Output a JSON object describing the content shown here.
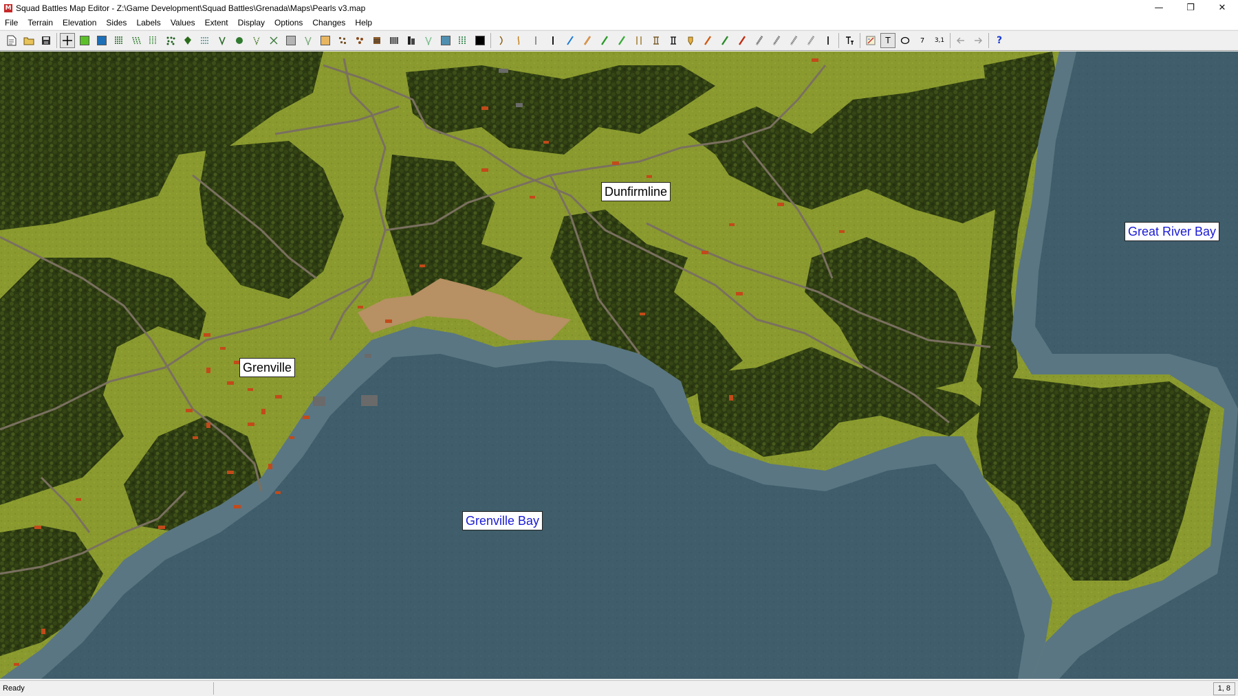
{
  "window": {
    "title": "Squad Battles Map Editor - Z:\\Game Development\\Squad Battles\\Grenada\\Maps\\Pearls v3.map",
    "app_icon_letter": "M",
    "controls": [
      "minimize",
      "restore",
      "close"
    ]
  },
  "menu": [
    "File",
    "Terrain",
    "Elevation",
    "Sides",
    "Labels",
    "Values",
    "Extent",
    "Display",
    "Options",
    "Changes",
    "Help"
  ],
  "toolbar": {
    "file_buttons": [
      "new-file-icon",
      "open-folder-icon",
      "save-icon"
    ],
    "terrain_buttons": [
      "select-cursor-icon",
      "clear-terrain-swatch",
      "water-swatch",
      "orchard-icon",
      "forest-icon",
      "light-forest-icon",
      "jungle-icon",
      "scrub-icon",
      "trees-icon",
      "marsh-icon",
      "rough-icon",
      "palm-icon",
      "brush-icon",
      "pavement-swatch",
      "forest-2-icon",
      "sand-swatch",
      "rubble-icon",
      "rocks-icon",
      "building-icon",
      "building-2-icon",
      "tall-building-icon",
      "fields-icon",
      "shallows-icon",
      "hedgerow-icon",
      "black-swatch"
    ],
    "line_buttons": [
      "stream-icon",
      "gully-icon",
      "trail-icon",
      "path-icon",
      "river-icon",
      "road-icon",
      "green-road-icon",
      "green-road-2-icon",
      "bridge-icon",
      "ford-icon",
      "blocked-icon",
      "pointer-icon",
      "road-2-icon",
      "wall-icon",
      "fence-icon",
      "railroad-icon",
      "railroad-2-icon",
      "railroad-3-icon",
      "railroad-4-icon",
      "line-icon"
    ],
    "other_buttons": [
      "text-style-icon",
      "map-edit-icon",
      "label-tool-icon",
      "ellipse-tool-icon",
      "value-tool-icon",
      "hex-number-icon",
      "undo-arrow-icon",
      "redo-arrow-icon",
      "help-icon"
    ],
    "glyphs": {
      "label_tool": "T",
      "value_tool": "7",
      "hex_number": "3,1",
      "help": "?"
    },
    "pressed": [
      "select-cursor-icon",
      "label-tool-icon"
    ]
  },
  "map": {
    "labels": [
      {
        "text": "Dunfirmline",
        "kind": "town"
      },
      {
        "text": "Grenville",
        "kind": "town"
      },
      {
        "text": "Great River Bay",
        "kind": "water"
      },
      {
        "text": "Grenville Bay",
        "kind": "water"
      }
    ],
    "colors": {
      "forest": "#2e3a12",
      "clear": "#8a9a2e",
      "water": "#3f5d6b",
      "shallow": "#5a7683",
      "beach": "#b79063",
      "road": "#7a7060"
    }
  },
  "status": {
    "text": "Ready",
    "coords": "1, 8"
  }
}
